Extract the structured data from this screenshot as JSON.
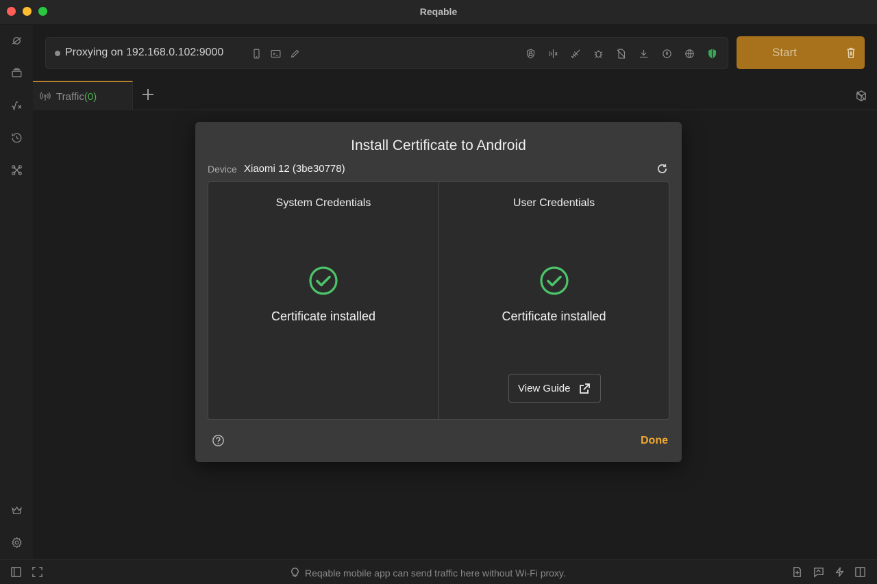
{
  "window": {
    "title": "Reqable"
  },
  "proxy": {
    "status_text": "Proxying on 192.168.0.102:9000"
  },
  "start_button": {
    "label": "Start"
  },
  "tabs": [
    {
      "label": "Traffic",
      "count": "(0)"
    }
  ],
  "footer": {
    "hint": "Reqable mobile app can send traffic here without Wi-Fi proxy."
  },
  "dialog": {
    "title": "Install Certificate to Android",
    "device_label": "Device",
    "device_name": "Xiaomi 12 (3be30778)",
    "panels": [
      {
        "title": "System Credentials",
        "status": "Certificate installed"
      },
      {
        "title": "User Credentials",
        "status": "Certificate installed",
        "action": "View Guide"
      }
    ],
    "done_label": "Done"
  },
  "colors": {
    "accent": "#f0a830",
    "success": "#4cc46a",
    "start_button": "#a8721c"
  },
  "icons": {
    "sidebar": [
      "capture-icon",
      "collections-icon",
      "scripts-icon",
      "history-icon",
      "tools-icon",
      "crown-icon",
      "settings-icon"
    ],
    "proxybar": [
      "mobile-icon",
      "terminal-icon",
      "edit-icon",
      "ssl-icon",
      "compare-icon",
      "rewrite-icon",
      "debug-icon",
      "block-icon",
      "download-icon",
      "throttle-icon",
      "network-icon",
      "shield-icon"
    ]
  }
}
